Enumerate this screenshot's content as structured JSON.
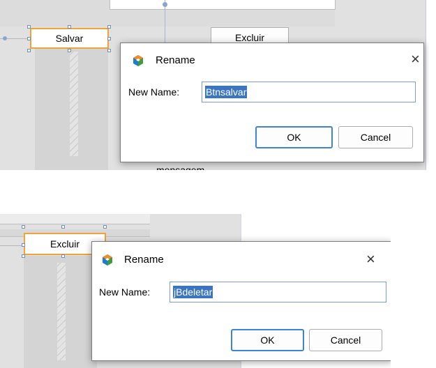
{
  "top": {
    "partial_top_text": "Excluir",
    "selected_button": "Salvar",
    "partial_bottom_text": "mensagem",
    "dialog": {
      "title": "Rename",
      "label": "New Name:",
      "value": "Btnsalvar",
      "ok": "OK",
      "cancel": "Cancel"
    }
  },
  "bottom": {
    "selected_button": "Excluir",
    "dialog": {
      "title": "Rename",
      "label": "New Name:",
      "value": "jBdeletar",
      "ok": "OK",
      "cancel": "Cancel"
    }
  },
  "icons": [
    "netbeans-logo-icon",
    "close-icon"
  ],
  "colors": {
    "selection_outline": "#f0a33a",
    "default_button": "#3f83d5",
    "text_selection": "#3a75c4"
  }
}
